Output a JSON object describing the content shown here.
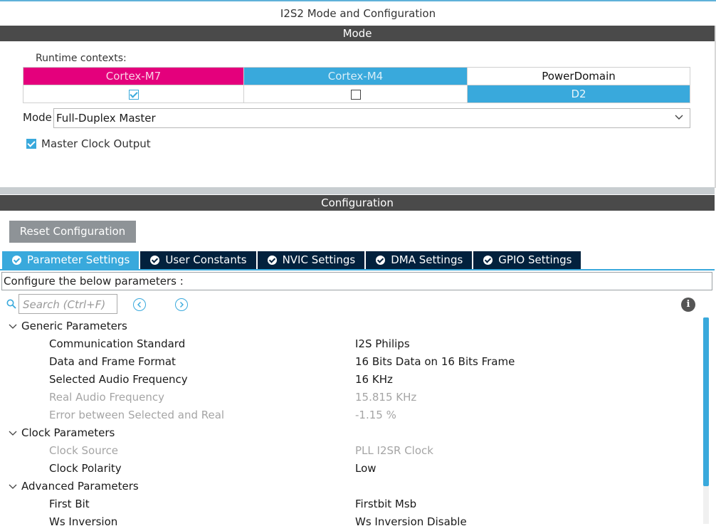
{
  "window": {
    "title": "I2S2 Mode and Configuration"
  },
  "mode_section": {
    "header": "Mode",
    "runtime_label": "Runtime contexts:",
    "contexts": [
      {
        "name": "Cortex-M7",
        "color": "#e4007c",
        "checked": true
      },
      {
        "name": "Cortex-M4",
        "color": "#39a9dc",
        "checked": false
      },
      {
        "name": "PowerDomain",
        "value": "D2"
      }
    ],
    "mode_label": "Mode",
    "mode_value": "Full-Duplex Master",
    "master_clock_output": {
      "label": "Master Clock Output",
      "checked": true
    }
  },
  "config_section": {
    "header": "Configuration",
    "reset_button": "Reset Configuration",
    "tabs": [
      {
        "label": "Parameter Settings",
        "active": true
      },
      {
        "label": "User Constants",
        "active": false
      },
      {
        "label": "NVIC Settings",
        "active": false
      },
      {
        "label": "DMA Settings",
        "active": false
      },
      {
        "label": "GPIO Settings",
        "active": false
      }
    ],
    "configure_text": "Configure the below parameters :",
    "search_placeholder": "Search (Ctrl+F)",
    "groups": [
      {
        "name": "Generic Parameters",
        "params": [
          {
            "name": "Communication Standard",
            "value": "I2S Philips",
            "enabled": true
          },
          {
            "name": "Data and Frame Format",
            "value": "16 Bits Data on 16 Bits Frame",
            "enabled": true
          },
          {
            "name": "Selected Audio Frequency",
            "value": "16 KHz",
            "enabled": true
          },
          {
            "name": "Real Audio Frequency",
            "value": "15.815 KHz",
            "enabled": false
          },
          {
            "name": "Error between Selected and Real",
            "value": "-1.15 %",
            "enabled": false
          }
        ]
      },
      {
        "name": "Clock Parameters",
        "params": [
          {
            "name": "Clock Source",
            "value": "PLL I2SR Clock",
            "enabled": false
          },
          {
            "name": "Clock Polarity",
            "value": "Low",
            "enabled": true
          }
        ]
      },
      {
        "name": "Advanced Parameters",
        "params": [
          {
            "name": "First Bit",
            "value": "Firstbit Msb",
            "enabled": true
          },
          {
            "name": "Ws Inversion",
            "value": "Ws Inversion Disable",
            "enabled": true
          }
        ]
      }
    ]
  },
  "colors": {
    "accent": "#39a9dc",
    "m7": "#e4007c",
    "tab_dark": "#02213d",
    "bar": "#4a4a4a"
  }
}
